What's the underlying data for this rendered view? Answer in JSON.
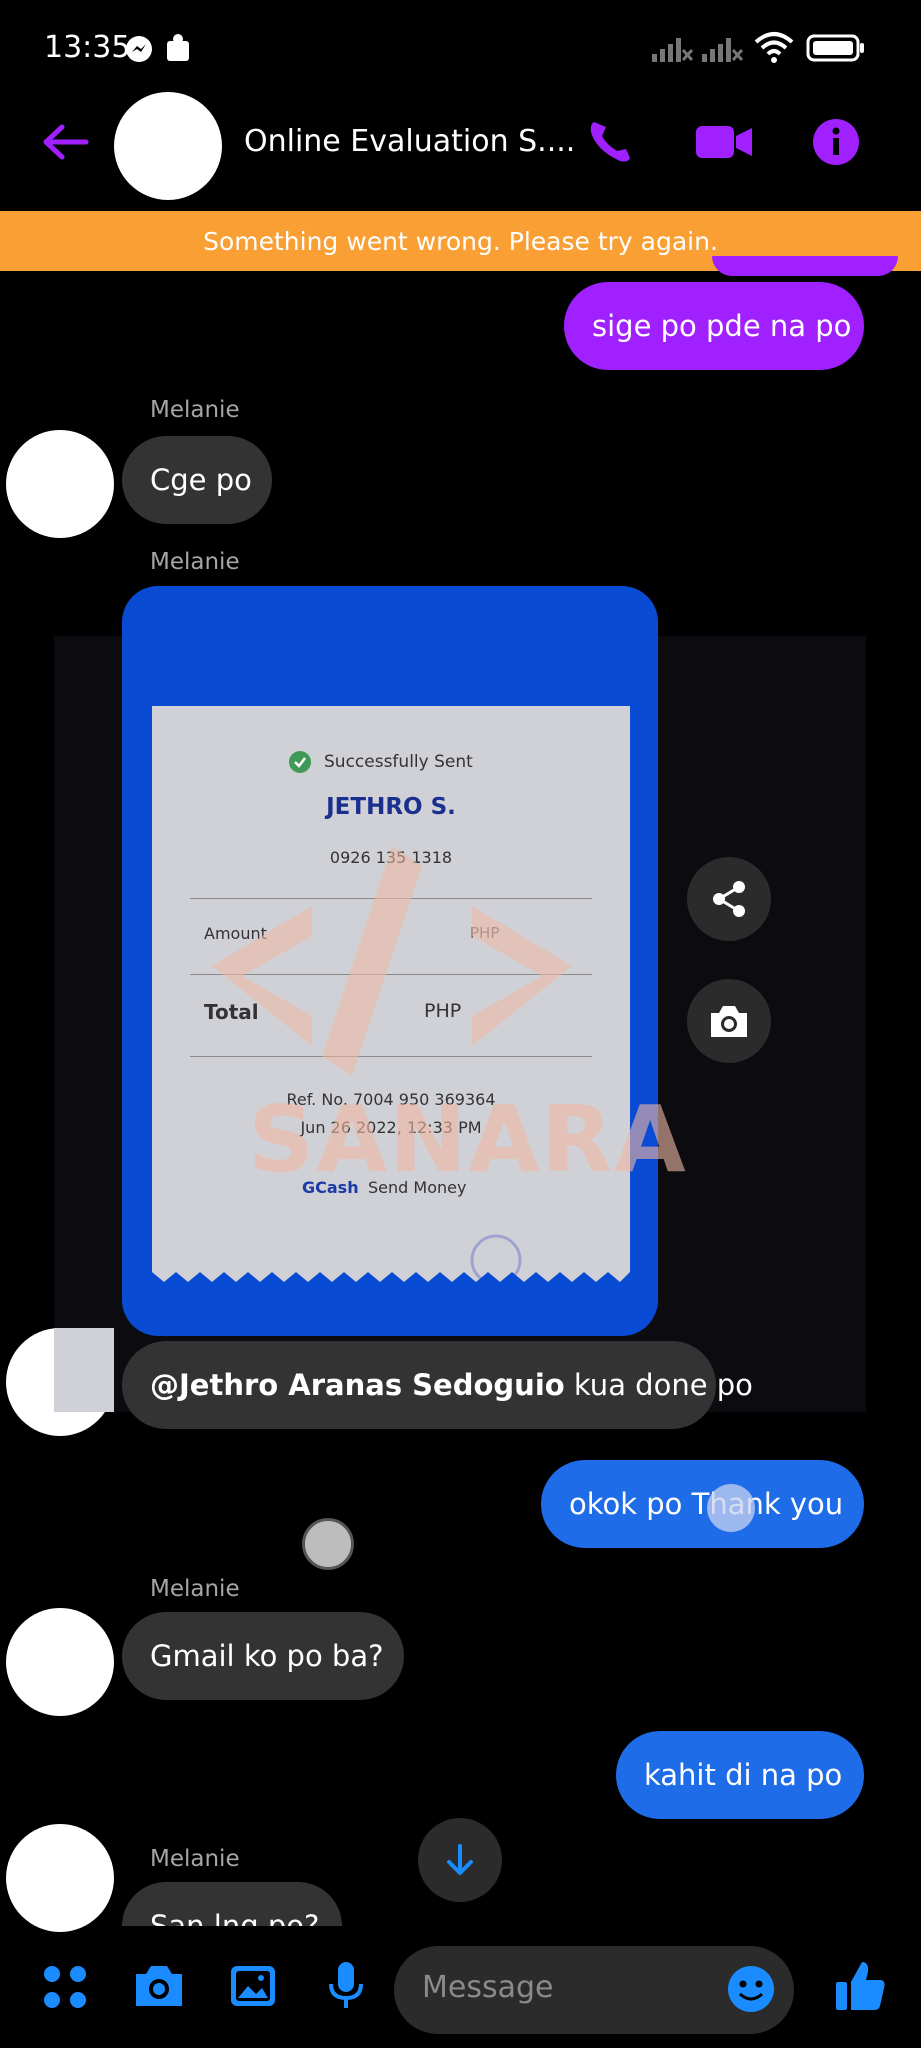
{
  "status_bar": {
    "time": "13:35",
    "icons": [
      "messenger-icon",
      "puzzle-icon",
      "signal-icon",
      "signal-icon",
      "wifi-icon",
      "battery-icon"
    ]
  },
  "header": {
    "title": "Online Evaluation S....",
    "icons": [
      "back-arrow-icon",
      "phone-icon",
      "video-icon",
      "info-icon"
    ]
  },
  "banner": {
    "text": "Something went wrong. Please try again."
  },
  "messages": {
    "m1": "sige po pde na po",
    "sender1": "Melanie",
    "m2": "Cge po",
    "sender2": "Melanie",
    "m3_mention": "@Jethro Aranas Sedoguio",
    "m3_text": " kua done po",
    "m4": "okok po Thank you",
    "sender3": "Melanie",
    "m5": "Gmail ko po ba?",
    "m6": "kahit di na po",
    "sender4": "Melanie",
    "m7": "San lng po?"
  },
  "receipt": {
    "status": "Successfully Sent",
    "name": "JETHRO S.",
    "phone": "0926 135 1318",
    "amount_label": "Amount",
    "amount_currency": "PHP",
    "total_label": "Total",
    "total_currency": "PHP",
    "ref": "Ref. No. 7004 950 369364",
    "date": "Jun 26 2022, 12:33 PM",
    "brand": "GCash",
    "service": "Send Money",
    "watermark": "SANARA"
  },
  "composer": {
    "placeholder": "Message"
  },
  "colors": {
    "purple": "#a020ff",
    "blue": "#1e6ce8",
    "banner": "#f99f34",
    "accent_icon": "#1a8cff"
  }
}
